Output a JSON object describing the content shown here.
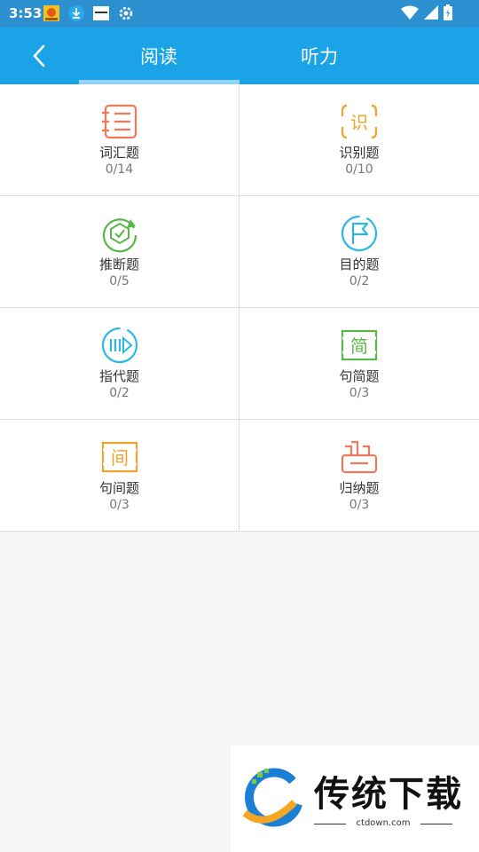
{
  "status_bar": {
    "time": "3:53"
  },
  "header": {
    "tabs": [
      {
        "label": "阅读",
        "active": true
      },
      {
        "label": "听力",
        "active": false
      }
    ]
  },
  "categories": [
    {
      "label": "词汇题",
      "count": "0/14",
      "icon": "list-notebook-icon",
      "color": "#ef7a5a"
    },
    {
      "label": "识别题",
      "count": "0/10",
      "icon": "recognize-icon",
      "color": "#f2a12b"
    },
    {
      "label": "推断题",
      "count": "0/5",
      "icon": "inference-cycle-icon",
      "color": "#5bb64a"
    },
    {
      "label": "目的题",
      "count": "0/2",
      "icon": "flag-icon",
      "color": "#2db6e8"
    },
    {
      "label": "指代题",
      "count": "0/2",
      "icon": "play-forward-icon",
      "color": "#2db6e8"
    },
    {
      "label": "句简题",
      "count": "0/3",
      "icon": "simplify-icon",
      "color": "#5bb64a"
    },
    {
      "label": "句间题",
      "count": "0/3",
      "icon": "between-icon",
      "color": "#f2a12b"
    },
    {
      "label": "归纳题",
      "count": "0/3",
      "icon": "summary-box-icon",
      "color": "#ef7a5a"
    }
  ],
  "watermark": {
    "title": "传统下载",
    "url": "ctdown.com"
  }
}
